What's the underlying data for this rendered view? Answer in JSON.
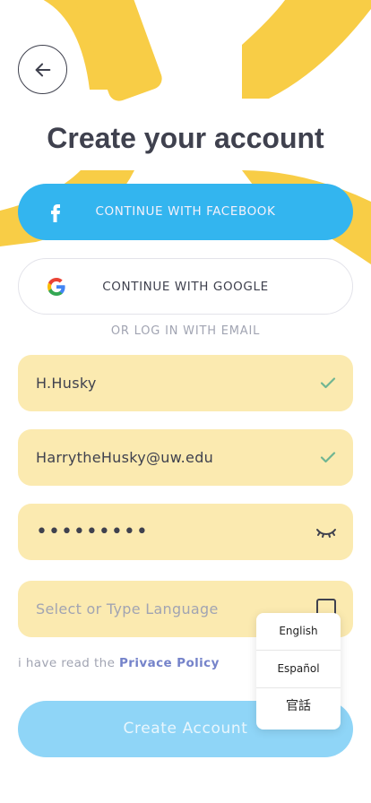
{
  "header": {
    "back_icon": "arrow-left-icon",
    "title": "Create your account"
  },
  "social": {
    "facebook_label": "CONTINUE WITH FACEBOOK",
    "facebook_icon": "facebook-icon",
    "google_label": "CONTINUE WITH GOOGLE",
    "google_icon": "google-icon"
  },
  "divider_text": "OR LOG IN WITH EMAIL",
  "form": {
    "username": {
      "value": "H.Husky",
      "status_icon": "check-icon"
    },
    "email": {
      "value": "HarrytheHusky@uw.edu",
      "status_icon": "check-icon"
    },
    "password": {
      "value": "•••••••••",
      "toggle_icon": "eye-closed-icon"
    },
    "language": {
      "placeholder": "Select or Type Language",
      "dropdown_icon": "dropdown-box-icon"
    }
  },
  "policy": {
    "prefix": "i have read the ",
    "link": "Privace Policy"
  },
  "create_button_label": "Create Account",
  "language_options": [
    "English",
    "Español",
    "官話"
  ],
  "colors": {
    "accent_yellow": "#f8cd46",
    "field_bg": "#fbeab0",
    "facebook_blue": "#33b5ef",
    "create_button": "#8fd5f7",
    "check_green": "#6fb592",
    "policy_link": "#7583ca"
  }
}
